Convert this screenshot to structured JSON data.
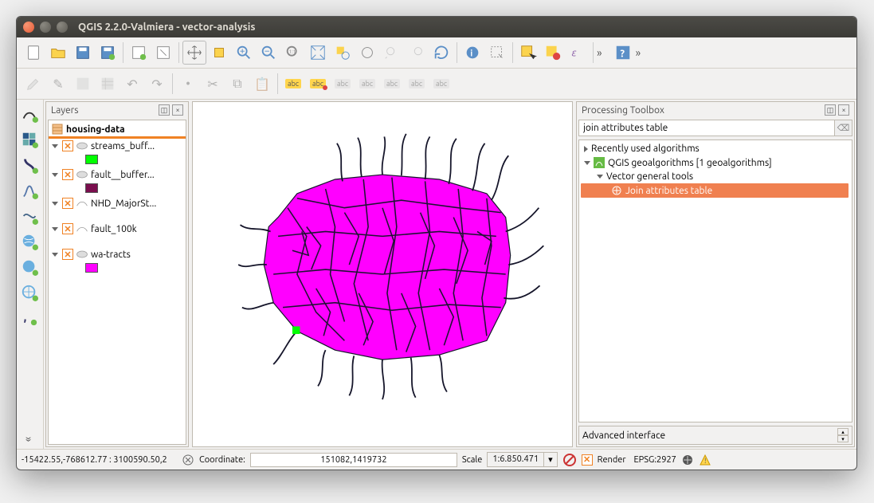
{
  "window": {
    "title": "QGIS 2.2.0-Valmiera - vector-analysis"
  },
  "layers_panel": {
    "title": "Layers",
    "selected": "housing-data",
    "items": [
      {
        "name": "streams_buff...",
        "swatch": "#00ff00",
        "line": false
      },
      {
        "name": "fault__buffer...",
        "swatch": "#7a0e4e",
        "line": false
      },
      {
        "name": "NHD_MajorSt...",
        "line": true
      },
      {
        "name": "fault_100k",
        "line": true
      },
      {
        "name": "wa-tracts",
        "swatch": "#ff00ff",
        "line": false
      }
    ]
  },
  "toolbox": {
    "title": "Processing Toolbox",
    "search": "join attributes table",
    "recent": "Recently used algorithms",
    "qgis": "QGIS geoalgorithms [1 geoalgorithms]",
    "vector": "Vector general tools",
    "algo": "Join attributes table",
    "advanced": "Advanced interface"
  },
  "status": {
    "extent": "-15422.55,-768612.77 : 3100590.50,2",
    "coord_label": "Coordinate:",
    "coord_value": "151082,1419732",
    "scale_label": "Scale",
    "scale_value": "1:6.850.471",
    "render": "Render",
    "epsg": "EPSG:2927"
  }
}
